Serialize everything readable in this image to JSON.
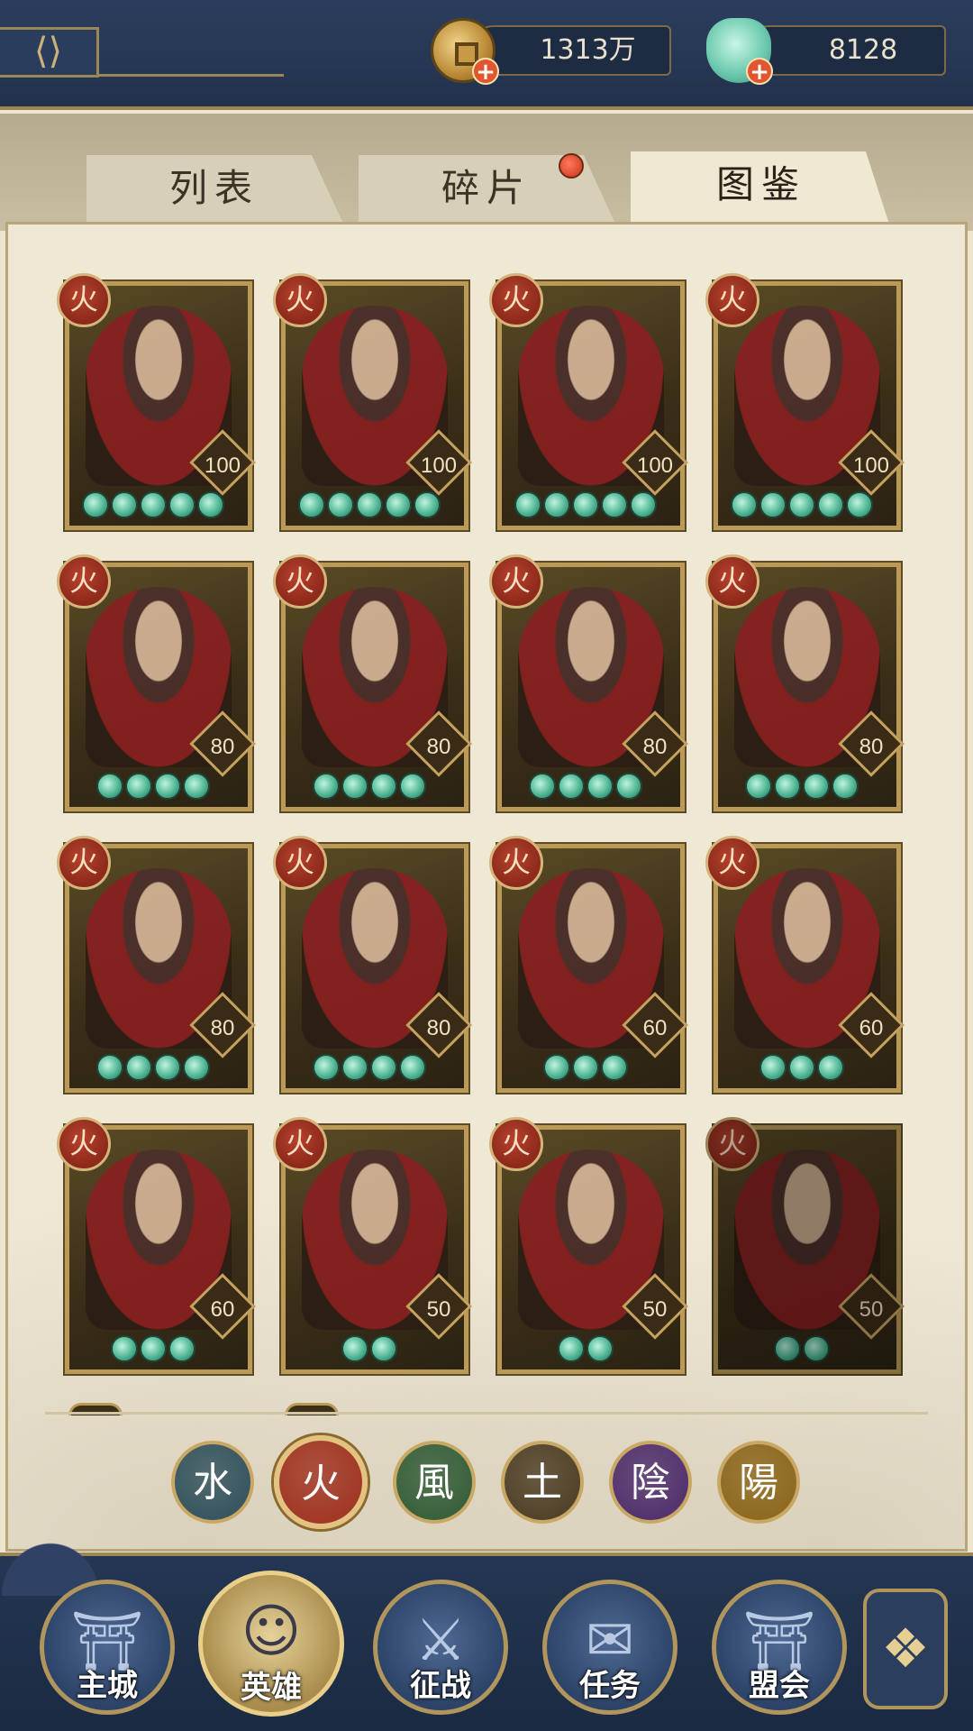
{
  "currency": {
    "coins": "1313万",
    "jade": "8128"
  },
  "tabs": [
    {
      "label": "列表",
      "active": false
    },
    {
      "label": "碎片",
      "active": false,
      "has_notification": true
    },
    {
      "label": "图鉴",
      "active": true
    }
  ],
  "heroes": [
    {
      "element": "火",
      "level": "100",
      "stars": 5
    },
    {
      "element": "火",
      "level": "100",
      "stars": 5
    },
    {
      "element": "火",
      "level": "100",
      "stars": 5
    },
    {
      "element": "火",
      "level": "100",
      "stars": 5
    },
    {
      "element": "火",
      "level": "80",
      "stars": 4
    },
    {
      "element": "火",
      "level": "80",
      "stars": 4
    },
    {
      "element": "火",
      "level": "80",
      "stars": 4
    },
    {
      "element": "火",
      "level": "80",
      "stars": 4
    },
    {
      "element": "火",
      "level": "80",
      "stars": 4
    },
    {
      "element": "火",
      "level": "80",
      "stars": 4
    },
    {
      "element": "火",
      "level": "60",
      "stars": 3
    },
    {
      "element": "火",
      "level": "60",
      "stars": 3
    },
    {
      "element": "火",
      "level": "60",
      "stars": 3
    },
    {
      "element": "火",
      "level": "50",
      "stars": 2
    },
    {
      "element": "火",
      "level": "50",
      "stars": 2
    },
    {
      "element": "火",
      "level": "50",
      "stars": 2,
      "dimmed": true
    }
  ],
  "element_filters": [
    {
      "glyph": "水",
      "color": "#2e4f5a",
      "selected": false
    },
    {
      "glyph": "火",
      "color": "#9e2f1d",
      "selected": true
    },
    {
      "glyph": "風",
      "color": "#2f5a34",
      "selected": false
    },
    {
      "glyph": "土",
      "color": "#4a3a22",
      "selected": false
    },
    {
      "glyph": "陰",
      "color": "#4b2a6a",
      "selected": false
    },
    {
      "glyph": "陽",
      "color": "#8a6418",
      "selected": false
    }
  ],
  "nav": [
    {
      "label": "主城",
      "icon": "city-gate-icon",
      "active": false
    },
    {
      "label": "英雄",
      "icon": "hero-portrait-icon",
      "active": true
    },
    {
      "label": "征战",
      "icon": "scroll-battle-icon",
      "active": false
    },
    {
      "label": "任务",
      "icon": "task-scroll-icon",
      "active": false
    },
    {
      "label": "盟会",
      "icon": "alliance-gate-icon",
      "active": false
    }
  ],
  "menu_icon": "flower-menu-icon"
}
